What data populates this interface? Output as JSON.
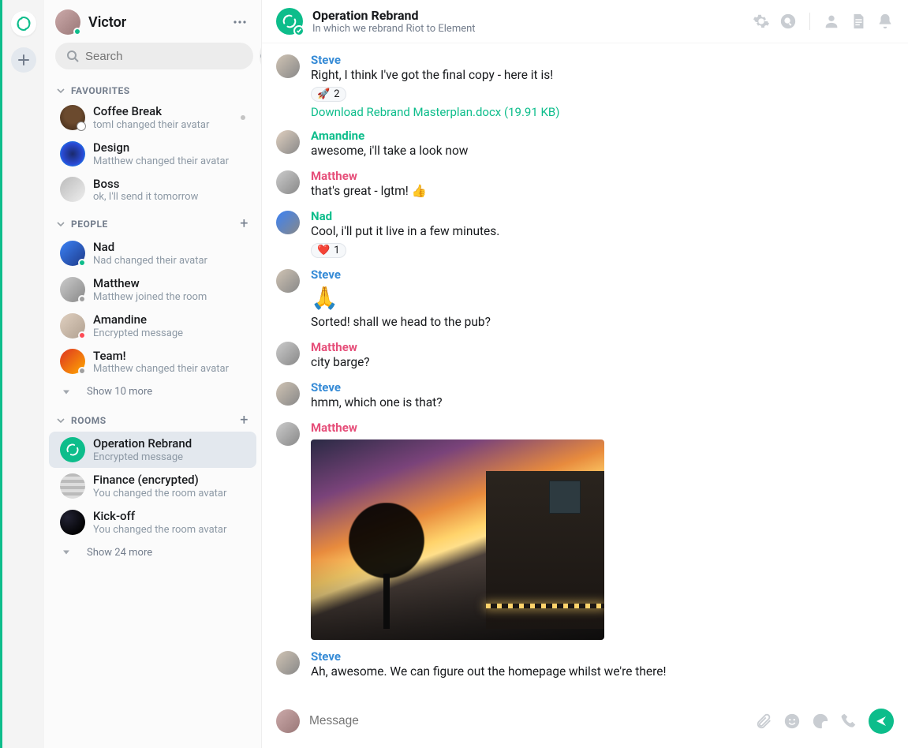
{
  "rail": {},
  "user": {
    "name": "Victor"
  },
  "search": {
    "placeholder": "Search"
  },
  "sections": {
    "favourites": {
      "label": "FAVOURITES"
    },
    "people": {
      "label": "PEOPLE",
      "show_more": "Show 10 more"
    },
    "rooms": {
      "label": "ROOMS",
      "show_more": "Show 24 more"
    }
  },
  "favourites": [
    {
      "name": "Coffee Break",
      "sub": "toml changed their avatar",
      "avatar": "ra-coffee",
      "presence": "globe",
      "unread": true
    },
    {
      "name": "Design",
      "sub": "Matthew changed their avatar",
      "avatar": "ra-design"
    },
    {
      "name": "Boss",
      "sub": "ok, I'll send it tomorrow",
      "avatar": "ra-boss"
    }
  ],
  "people": [
    {
      "name": "Nad",
      "sub": "Nad changed their avatar",
      "avatar": "ra-nad",
      "presence": "online"
    },
    {
      "name": "Matthew",
      "sub": "Matthew joined the room",
      "avatar": "ra-matt",
      "presence": "grey"
    },
    {
      "name": "Amandine",
      "sub": "Encrypted message",
      "avatar": "ra-amandine",
      "presence": "red"
    },
    {
      "name": "Team!",
      "sub": "Matthew changed their avatar",
      "avatar": "ra-team",
      "presence": "grey"
    }
  ],
  "rooms": [
    {
      "name": "Operation Rebrand",
      "sub": "Encrypted message",
      "avatar": "ra-op",
      "selected": true
    },
    {
      "name": "Finance (encrypted)",
      "sub": "You changed the room avatar",
      "avatar": "ra-fin"
    },
    {
      "name": "Kick-off",
      "sub": "You changed the room avatar",
      "avatar": "ra-rocket"
    }
  ],
  "room_header": {
    "title": "Operation Rebrand",
    "topic": "In which we rebrand Riot to Element"
  },
  "messages": [
    {
      "sender": "Steve",
      "cls": "steve",
      "avatar": "ra-matt",
      "text": "Right, I think I've got the final copy - here it is!",
      "reaction": {
        "emoji": "🚀",
        "count": "2"
      },
      "file": {
        "label": "Download Rebrand Masterplan.docx (19.91 KB)"
      }
    },
    {
      "sender": "Amandine",
      "cls": "amandine",
      "avatar": "ra-amandine",
      "text": "awesome, i'll take a look now"
    },
    {
      "sender": "Matthew",
      "cls": "matthew",
      "avatar": "ra-matt",
      "text": "that's great - lgtm! 👍"
    },
    {
      "sender": "Nad",
      "cls": "nad",
      "avatar": "ra-nad",
      "text": "Cool, i'll put it live in a few minutes.",
      "reaction": {
        "emoji": "❤️",
        "count": "1"
      }
    },
    {
      "sender": "Steve",
      "cls": "steve",
      "avatar": "ra-matt",
      "bigEmoji": "🙏",
      "text": "Sorted! shall we head to the pub?"
    },
    {
      "sender": "Matthew",
      "cls": "matthew",
      "avatar": "ra-matt",
      "text": "city barge?"
    },
    {
      "sender": "Steve",
      "cls": "steve",
      "avatar": "ra-matt",
      "text": "hmm, which one is that?"
    },
    {
      "sender": "Matthew",
      "cls": "matthew",
      "avatar": "ra-matt",
      "image": true
    },
    {
      "sender": "Steve",
      "cls": "steve",
      "avatar": "ra-matt",
      "text": "Ah, awesome. We can figure out the homepage whilst we're there!"
    }
  ],
  "composer": {
    "placeholder": "Message"
  }
}
